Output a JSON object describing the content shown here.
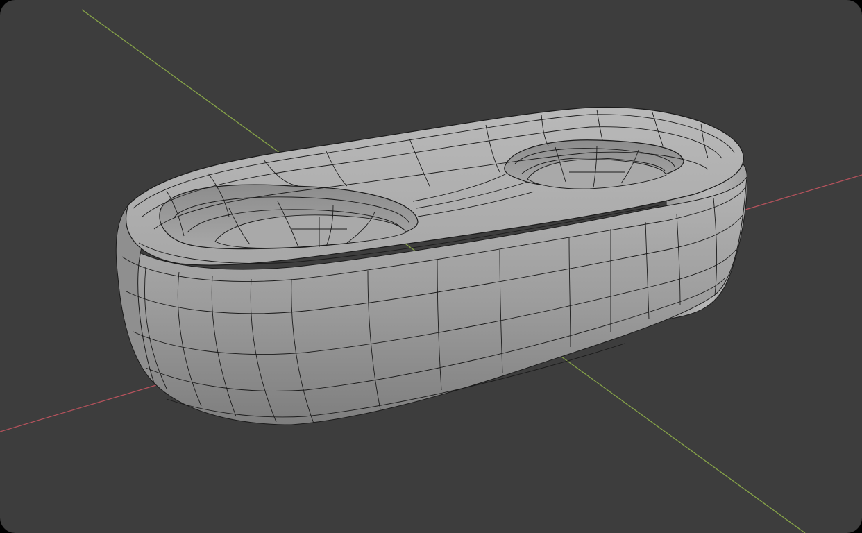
{
  "viewport": {
    "background_color": "#3d3d3d",
    "frame_color": "#000000",
    "view_mode": "solid-shading-wireframe-overlay"
  },
  "axes": {
    "x_axis_color": "#b5525c",
    "y_axis_color": "#86a348"
  },
  "mesh": {
    "object": "rounded-rectangular-tray-with-two-oval-recesses",
    "recess_count": 2,
    "surface_color": "#a4a4a4",
    "wire_color": "#1b1b1b"
  }
}
